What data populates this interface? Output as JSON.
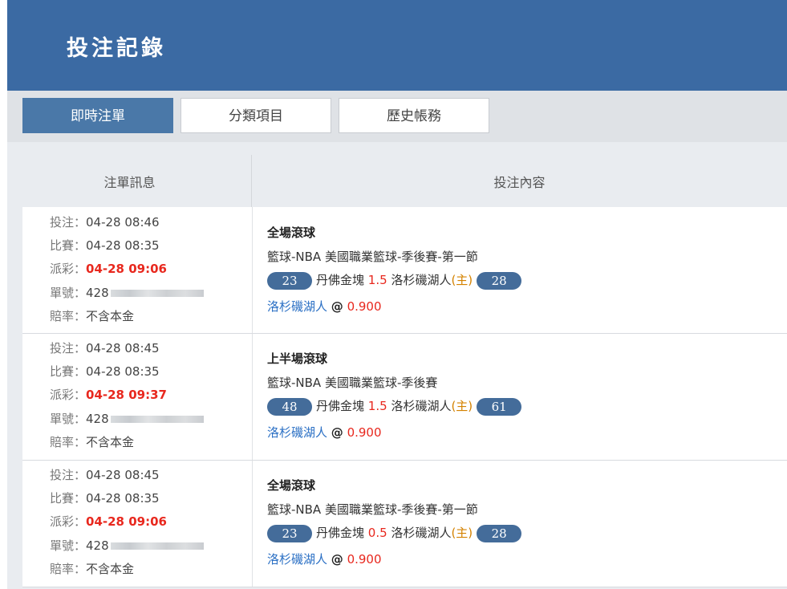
{
  "header": {
    "title": "投注記錄"
  },
  "tabs": [
    {
      "label": "即時注單",
      "active": true
    },
    {
      "label": "分類項目",
      "active": false
    },
    {
      "label": "歷史帳務",
      "active": false
    }
  ],
  "table": {
    "columns": [
      "注單訊息",
      "投注內容"
    ],
    "labels": {
      "bet": "投注：",
      "match": "比賽：",
      "payout": "派彩：",
      "ticket": "單號：",
      "odds_type": "賠率："
    },
    "rows": [
      {
        "bet_time": "04-28 08:46",
        "match_time": "04-28 08:35",
        "payout_time": "04-28 09:06",
        "ticket_prefix": "428",
        "odds_type": "不含本金",
        "market": "全場滾球",
        "league": "籃球-NBA 美國職業籃球-季後賽-第一節",
        "away_score": "23",
        "away_team": "丹佛金塊",
        "handicap": "1.5",
        "home_team": "洛杉磯湖人",
        "home_mark": "(主)",
        "home_score": "28",
        "pick": "洛杉磯湖人",
        "at": "@",
        "odds": "0.900"
      },
      {
        "bet_time": "04-28 08:45",
        "match_time": "04-28 08:35",
        "payout_time": "04-28 09:37",
        "ticket_prefix": "428",
        "odds_type": "不含本金",
        "market": "上半場滾球",
        "league": "籃球-NBA 美國職業籃球-季後賽",
        "away_score": "48",
        "away_team": "丹佛金塊",
        "handicap": "1.5",
        "home_team": "洛杉磯湖人",
        "home_mark": "(主)",
        "home_score": "61",
        "pick": "洛杉磯湖人",
        "at": "@",
        "odds": "0.900"
      },
      {
        "bet_time": "04-28 08:45",
        "match_time": "04-28 08:35",
        "payout_time": "04-28 09:06",
        "ticket_prefix": "428",
        "odds_type": "不含本金",
        "market": "全場滾球",
        "league": "籃球-NBA 美國職業籃球-季後賽-第一節",
        "away_score": "23",
        "away_team": "丹佛金塊",
        "handicap": "0.5",
        "home_team": "洛杉磯湖人",
        "home_mark": "(主)",
        "home_score": "28",
        "pick": "洛杉磯湖人",
        "at": "@",
        "odds": "0.900"
      }
    ]
  }
}
